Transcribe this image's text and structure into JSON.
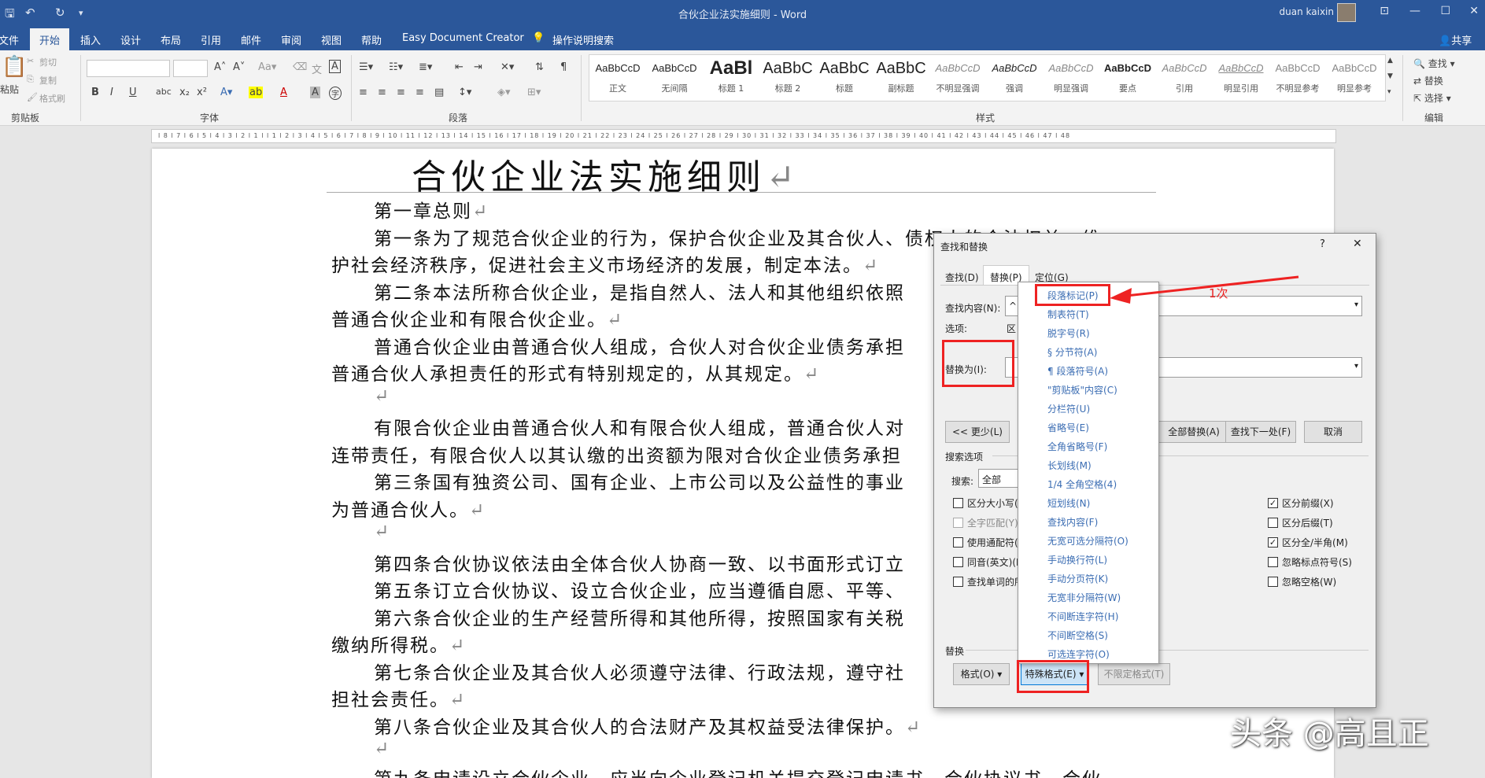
{
  "titlebar": {
    "doc_title": "合伙企业法实施细则 - Word",
    "user": "duan kaixin"
  },
  "tabs": [
    "文件",
    "开始",
    "插入",
    "设计",
    "布局",
    "引用",
    "邮件",
    "审阅",
    "视图",
    "帮助",
    "Easy Document Creator",
    "操作说明搜索"
  ],
  "share": "共享",
  "clipboard": {
    "paste": "粘贴",
    "cut": "剪切",
    "copy": "复制",
    "painter": "格式刷",
    "group": "剪贴板"
  },
  "groups": {
    "font": "字体",
    "paragraph": "段落",
    "styles": "样式",
    "editing": "编辑"
  },
  "styles": [
    {
      "preview": "AaBbCcD",
      "name": "正文"
    },
    {
      "preview": "AaBbCcD",
      "name": "无间隔"
    },
    {
      "preview": "AaBl",
      "name": "标题 1"
    },
    {
      "preview": "AaBbC",
      "name": "标题 2"
    },
    {
      "preview": "AaBbC",
      "name": "标题"
    },
    {
      "preview": "AaBbC",
      "name": "副标题"
    },
    {
      "preview": "AaBbCcD",
      "name": "不明显强调"
    },
    {
      "preview": "AaBbCcD",
      "name": "强调"
    },
    {
      "preview": "AaBbCcD",
      "name": "明显强调"
    },
    {
      "preview": "AaBbCcD",
      "name": "要点"
    },
    {
      "preview": "AaBbCcD",
      "name": "引用"
    },
    {
      "preview": "AaBbCcD",
      "name": "明显引用"
    },
    {
      "preview": "AaBbCcD",
      "name": "不明显参考"
    },
    {
      "preview": "AaBbCcD",
      "name": "明显参考"
    }
  ],
  "editing": {
    "find": "查找",
    "replace": "替换",
    "select": "选择"
  },
  "ruler": "l 8 l 7 l 6 l 5 l 4 l 3 l 2 l 1 l   l 1 l 2 l 3 l 4 l 5 l 6 l 7 l 8 l 9 l 10 l 11 l 12 l 13 l 14 l 15 l 16 l 17 l 18 l 19 l 20 l 21 l 22 l 23 l 24 l 25 l 26 l 27 l 28 l 29 l 30 l 31 l 32 l 33 l 34 l 35 l 36 l 37 l 38 l 39 l 40 l 41 l 42 l 43 l 44 l 45 l 46 l 47 l 48",
  "doc": {
    "title": "合伙企业法实施细则",
    "mark": "↵",
    "lines": [
      "第一章总则",
      "第一条为了规范合伙企业的行为，保护合伙企业及其合伙人、债权人的合法权益，维",
      "护社会经济秩序，促进社会主义市场经济的发展，制定本法。",
      "第二条本法所称合伙企业，是指自然人、法人和其他组织依照",
      "普通合伙企业和有限合伙企业。",
      "普通合伙企业由普通合伙人组成，合伙人对合伙企业债务承担",
      "普通合伙人承担责任的形式有特别规定的，从其规定。",
      "有限合伙企业由普通合伙人和有限合伙人组成，普通合伙人对",
      "连带责任，有限合伙人以其认缴的出资额为限对合伙企业债务承担",
      "第三条国有独资公司、国有企业、上市公司以及公益性的事业",
      "为普通合伙人。",
      "第四条合伙协议依法由全体合伙人协商一致、以书面形式订立",
      "第五条订立合伙协议、设立合伙企业，应当遵循自愿、平等、",
      "第六条合伙企业的生产经营所得和其他所得，按照国家有关税",
      "缴纳所得税。",
      "第七条合伙企业及其合伙人必须遵守法律、行政法规，遵守社",
      "担社会责任。",
      "第八条合伙企业及其合伙人的合法财产及其权益受法律保护。",
      "第九条申请设立合伙企业，应当向企业登记机关提交登记申请书、合伙协议书、合伙"
    ]
  },
  "dialog": {
    "title": "查找和替换",
    "help": "?",
    "close": "✕",
    "tabs": [
      "查找(D)",
      "替换(P)",
      "定位(G)"
    ],
    "find_label": "查找内容(N):",
    "find_value": "^p",
    "options_label": "选项:",
    "options_value": "区分全/半角",
    "replace_label": "替换为(I):",
    "less_btn": "<< 更少(L)",
    "replace_all": "全部替换(A)",
    "find_next": "查找下一处(F)",
    "cancel": "取消",
    "search_options": "搜索选项",
    "search_label": "搜索:",
    "search_value": "全部",
    "left_checks": [
      {
        "label": "区分大小写(H)",
        "checked": false
      },
      {
        "label": "全字匹配(Y)",
        "checked": false
      },
      {
        "label": "使用通配符(U)",
        "checked": false
      },
      {
        "label": "同音(英文)(K)",
        "checked": false
      },
      {
        "label": "查找单词的所有形式(英文)(W)",
        "checked": false
      }
    ],
    "right_checks": [
      {
        "label": "区分前缀(X)",
        "checked": true
      },
      {
        "label": "区分后缀(T)",
        "checked": false
      },
      {
        "label": "区分全/半角(M)",
        "checked": true
      },
      {
        "label": "忽略标点符号(S)",
        "checked": false
      },
      {
        "label": "忽略空格(W)",
        "checked": false
      }
    ],
    "replace_section": "替换",
    "format_btn": "格式(O) ▾",
    "special_btn": "特殊格式(E) ▾",
    "no_format_btn": "不限定格式(T)"
  },
  "special_menu": [
    "段落标记(P)",
    "制表符(T)",
    "脱字号(R)",
    "§ 分节符(A)",
    "¶ 段落符号(A)",
    "\"剪贴板\"内容(C)",
    "分栏符(U)",
    "省略号(E)",
    "全角省略号(F)",
    "长划线(M)",
    "1/4 全角空格(4)",
    "短划线(N)",
    "查找内容(F)",
    "无宽可选分隔符(O)",
    "手动换行符(L)",
    "手动分页符(K)",
    "无宽非分隔符(W)",
    "不间断连字符(H)",
    "不间断空格(S)",
    "可选连字符(O)"
  ],
  "annotation": "1次",
  "watermark": "头条 @高且正",
  "colors": {
    "word_blue": "#2b579a",
    "highlight_red": "#e22222"
  }
}
